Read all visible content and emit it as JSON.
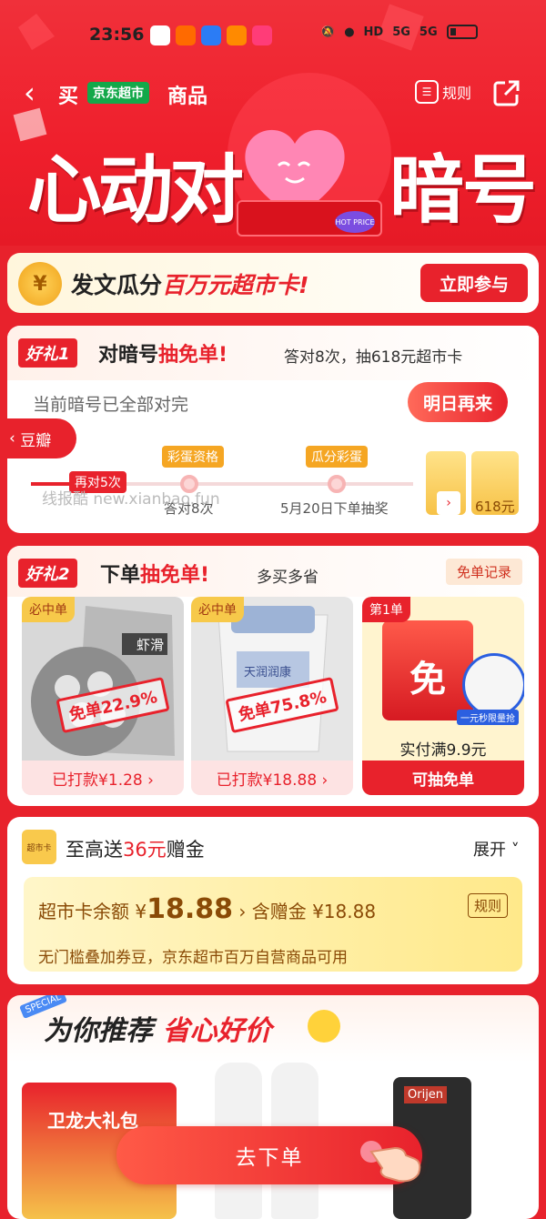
{
  "status_bar": {
    "time": "23:56",
    "network1": "HD",
    "network2": "5G",
    "network3": "5G"
  },
  "nav": {
    "back": "‹",
    "buy": "买",
    "jd_tag": "京东超市",
    "goods": "商品",
    "rule_label": "规则"
  },
  "hero": {
    "title_left": "心动对",
    "title_right": "暗号",
    "hot_price": "HOT PRICE"
  },
  "banner": {
    "coin": "¥",
    "text_plain": "发文瓜分",
    "text_highlight": "百万元超市卡!",
    "join_button": "立即参与"
  },
  "gift1": {
    "tag": "好礼1",
    "title_plain": "对暗号",
    "title_highlight": "抽免单!",
    "subtitle": "答对8次，抽618元超市卡",
    "current_status": "当前暗号已全部对完",
    "tomorrow_button": "明日再来",
    "progress": {
      "answer_again": "再对5次",
      "egg_qualify": "彩蛋资格",
      "egg_share": "瓜分彩蛋",
      "step1_label": "答对8次",
      "step2_label": "5月20日下单抽奖",
      "card_label": "618元"
    },
    "watermark": "线报酷 new.xianbao.fun"
  },
  "side_tab": {
    "label": "豆瓣"
  },
  "gift2": {
    "tag": "好礼2",
    "title_plain": "下单",
    "title_highlight": "抽免单!",
    "subtitle": "多买多省",
    "record_button": "免单记录",
    "products": [
      {
        "badge": "必中单",
        "pack_text": "虾滑",
        "stamp": "免单22.9%",
        "footer": "已打款¥1.28 ›"
      },
      {
        "badge": "必中单",
        "pack_text": "天润润康",
        "stamp": "免单75.8%",
        "footer": "已打款¥18.88 ›"
      },
      {
        "badge": "第1单",
        "bag_text": "免",
        "flash_label": "一元秒限量抢",
        "condition": "实付满9.9元",
        "footer": "可抽免单"
      }
    ]
  },
  "coupon": {
    "icon_text": "超市卡",
    "title_plain": "至高送",
    "title_highlight": "36元",
    "title_tail": "赠金",
    "expand": "展开 ˅",
    "balance_label": "超市卡余额",
    "balance_currency": "¥",
    "balance_value": "18.88",
    "balance_arrow": "›",
    "gift_label": "含赠金 ¥18.88",
    "rule": "规则",
    "desc": "无门槛叠加券豆，京东超市百万自营商品可用"
  },
  "recommend": {
    "special": "SPECIAL",
    "title_plain": "为你推荐",
    "title_highlight": "省心好价",
    "p1_text": "卫龙大礼包",
    "p3_text": "Orijen"
  },
  "checkout_button": "去下单",
  "colors": {
    "brand_red": "#e8222c",
    "jd_green": "#13a84a",
    "gold": "#f7c94a"
  }
}
